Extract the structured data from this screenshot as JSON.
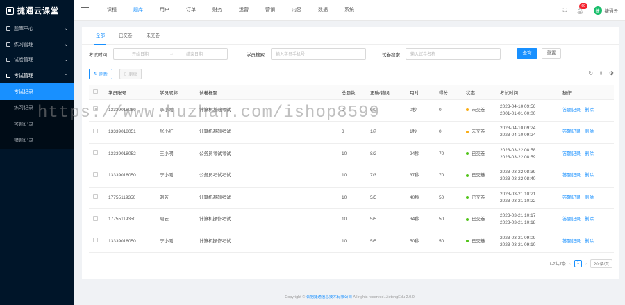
{
  "app": {
    "logo_text": "捷通云课堂"
  },
  "sidebar": {
    "items": [
      {
        "label": "题库中心",
        "chevron": "⌄"
      },
      {
        "label": "练习管理",
        "chevron": "⌄"
      },
      {
        "label": "试卷管理",
        "chevron": "⌄"
      },
      {
        "label": "考试管理",
        "chevron": "⌃"
      }
    ],
    "subitems": [
      {
        "label": "考试记录"
      },
      {
        "label": "练习记录"
      },
      {
        "label": "答题记录"
      },
      {
        "label": "错题记录"
      }
    ]
  },
  "header": {
    "nav": [
      "课程",
      "题库",
      "用户",
      "订单",
      "财务",
      "运营",
      "营销",
      "内容",
      "数据",
      "系统"
    ],
    "active_nav": 1,
    "notification_count": "60",
    "user_name": "捷通云",
    "avatar_text": "捷"
  },
  "tabs": [
    "全部",
    "已交卷",
    "未交卷"
  ],
  "filters": {
    "time_label": "考试时间",
    "start_placeholder": "开始日期",
    "end_placeholder": "结束日期",
    "student_label": "学员搜索",
    "student_placeholder": "输入学员手机号",
    "paper_label": "试卷搜索",
    "paper_placeholder": "输入试卷名称",
    "search_button": "查询",
    "reset_button": "重置"
  },
  "toolbar": {
    "refresh_button": "刷新",
    "delete_button": "删除"
  },
  "table": {
    "columns": [
      "学员账号",
      "学员昵称",
      "试卷标题",
      "总题数",
      "正确/错误",
      "用时",
      "得分",
      "状态",
      "考试时间",
      "操作"
    ],
    "rows": [
      {
        "account": "13339018050",
        "nick": "李小刚",
        "title": "计算机基础考试",
        "total": "0",
        "ratio": "0/0",
        "time": "0秒",
        "score": "0",
        "status": "未交卷",
        "start": "2023-04-10 09:56",
        "end": "2001-01-01 00:00",
        "status_color": "#faad14"
      },
      {
        "account": "13339018051",
        "nick": "张小红",
        "title": "计算机基础考试",
        "total": "3",
        "ratio": "1/7",
        "time": "1秒",
        "score": "0",
        "status": "未交卷",
        "start": "2023-04-10 09:24",
        "end": "2023-04-10 09:24",
        "status_color": "#faad14"
      },
      {
        "account": "13339018052",
        "nick": "王小明",
        "title": "公务员考试考试",
        "total": "10",
        "ratio": "8/2",
        "time": "24秒",
        "score": "70",
        "status": "已交卷",
        "start": "2023-03-22 08:58",
        "end": "2023-03-22 08:59",
        "status_color": "#52c41a"
      },
      {
        "account": "13339018050",
        "nick": "李小刚",
        "title": "公务员考试考试",
        "total": "10",
        "ratio": "7/3",
        "time": "37秒",
        "score": "70",
        "status": "已交卷",
        "start": "2023-03-22 08:39",
        "end": "2023-03-22 08:40",
        "status_color": "#52c41a"
      },
      {
        "account": "17755119350",
        "nick": "刘芳",
        "title": "计算机基础考试",
        "total": "10",
        "ratio": "5/5",
        "time": "40秒",
        "score": "50",
        "status": "已交卷",
        "start": "2023-03-21 10:21",
        "end": "2023-03-21 10:22",
        "status_color": "#52c41a"
      },
      {
        "account": "17755119350",
        "nick": "周云",
        "title": "计算机操作考试",
        "total": "10",
        "ratio": "5/5",
        "time": "34秒",
        "score": "50",
        "status": "已交卷",
        "start": "2023-03-21 10:17",
        "end": "2023-03-21 10:18",
        "status_color": "#52c41a"
      },
      {
        "account": "13339018050",
        "nick": "李小刚",
        "title": "计算机操作考试",
        "total": "10",
        "ratio": "5/5",
        "time": "50秒",
        "score": "50",
        "status": "已交卷",
        "start": "2023-03-21 09:09",
        "end": "2023-03-21 09:10",
        "status_color": "#52c41a"
      }
    ],
    "actions": [
      "答题记录",
      "删除"
    ]
  },
  "pager": {
    "summary": "1-7共7条",
    "prev": "‹",
    "current": "1",
    "next": "›",
    "size": "20 条/页"
  },
  "footer": {
    "prefix": "Copyright ©",
    "company": "合肥捷通信息技术有限公司",
    "suffix": "All rights reserved. JietongEdu 2.0.0"
  },
  "watermark": "https://www.huzhan.com/ishop8599"
}
